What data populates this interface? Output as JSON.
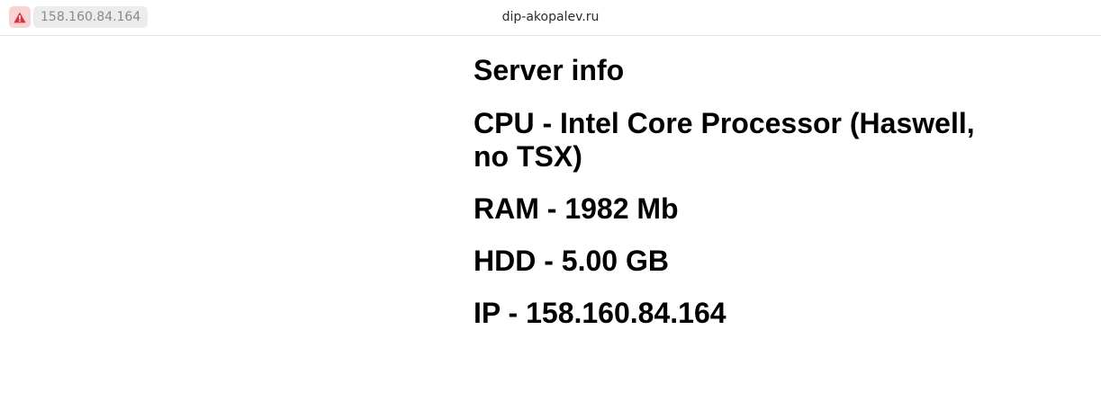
{
  "browser": {
    "url": "158.160.84.164",
    "page_title": "dip-akopalev.ru",
    "security_icon": "warning-triangle-icon",
    "warning_color": "#d9313b"
  },
  "page": {
    "heading": "Server info",
    "cpu": "CPU - Intel Core Processor (Haswell, no TSX)",
    "ram": "RAM - 1982 Mb",
    "hdd": "HDD - 5.00 GB",
    "ip": "IP - 158.160.84.164"
  }
}
